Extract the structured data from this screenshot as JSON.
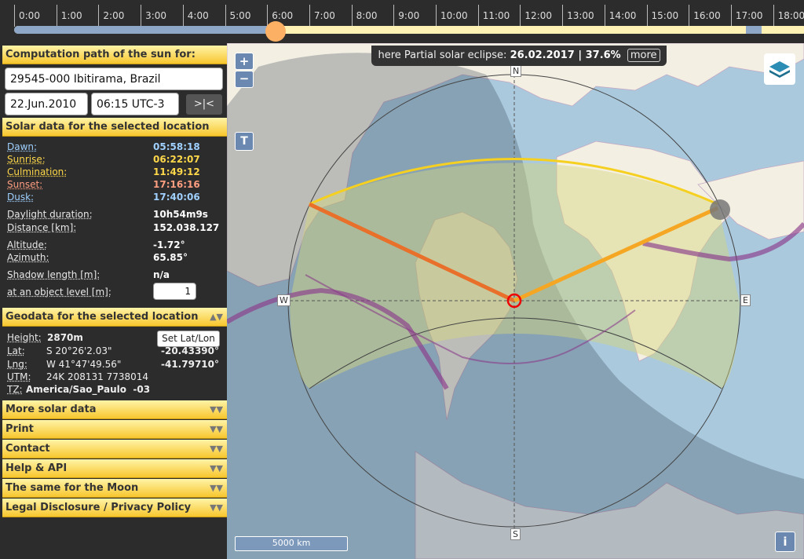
{
  "timeline": {
    "ticks": [
      "0:00",
      "1:00",
      "2:00",
      "3:00",
      "4:00",
      "5:00",
      "6:00",
      "7:00",
      "8:00",
      "9:00",
      "10:00",
      "11:00",
      "12:00",
      "13:00",
      "14:00",
      "15:00",
      "16:00",
      "17:00",
      "18:00"
    ],
    "current_time_fraction": 0.2604
  },
  "sidebar": {
    "path_header": "Computation path of the sun for:",
    "location_value": "29545-000 Ibitirama, Brazil",
    "date_value": "22.Jun.2010",
    "time_value": "06:15 UTC-3",
    "now_button": ">|<",
    "solar_header": "Solar data for the selected location",
    "solar_rows": [
      {
        "label": "Dawn:",
        "value": "05:58:18",
        "color": "#9fd0ff"
      },
      {
        "label": "Sunrise:",
        "value": "06:22:07",
        "color": "#ffd84a"
      },
      {
        "label": "Culmination:",
        "value": "11:49:12",
        "color": "#ffd84a"
      },
      {
        "label": "Sunset:",
        "value": "17:16:16",
        "color": "#ff9e80"
      },
      {
        "label": "Dusk:",
        "value": "17:40:06",
        "color": "#9fd0ff"
      }
    ],
    "daylight_label": "Daylight duration:",
    "daylight_value": "10h54m9s",
    "distance_label": "Distance [km]:",
    "distance_value": "152.038.127",
    "altitude_label": "Altitude:",
    "altitude_value": "-1.72°",
    "azimuth_label": "Azimuth:",
    "azimuth_value": "65.85°",
    "shadow_label": "Shadow length [m]:",
    "shadow_value": "n/a",
    "object_level_label": "at an object level [m]:",
    "object_level_value": "1",
    "geo_header": "Geodata for the selected location",
    "height_label": "Height:",
    "height_value": "2870m",
    "setlatlon_button": "Set Lat/Lon",
    "lat_label": "Lat:",
    "lat_dms": "S 20°26'2.03\"",
    "lat_dec": "-20.43390°",
    "lng_label": "Lng:",
    "lng_dms": "W 41°47'49.56\"",
    "lng_dec": "-41.79710°",
    "utm_label": "UTM:",
    "utm_value": "24K 208131 7738014",
    "tz_label": "TZ:",
    "tz_value": "America/Sao_Paulo  -03",
    "menu": [
      "More solar data",
      "Print",
      "Contact",
      "Help & API",
      "The same for the Moon",
      "Legal Disclosure / Privacy Policy"
    ]
  },
  "map": {
    "banner_prefix": "here Partial solar eclipse:",
    "banner_value": "26.02.2017 | 37.6%",
    "banner_more": "more",
    "zoom_in": "+",
    "zoom_out": "−",
    "terrain_button": "T",
    "info_button": "i",
    "scale_label": "5000 km",
    "north": "N",
    "south": "S",
    "east": "E",
    "west": "W",
    "layers_icon": "layers-icon"
  },
  "colors": {
    "accent_yellow": "#f7c62e",
    "sunrise_line": "#f5a623",
    "sunset_line": "#e8702a",
    "sun_path": "#f5d020",
    "eclipse_band": "#8b3a8b"
  }
}
